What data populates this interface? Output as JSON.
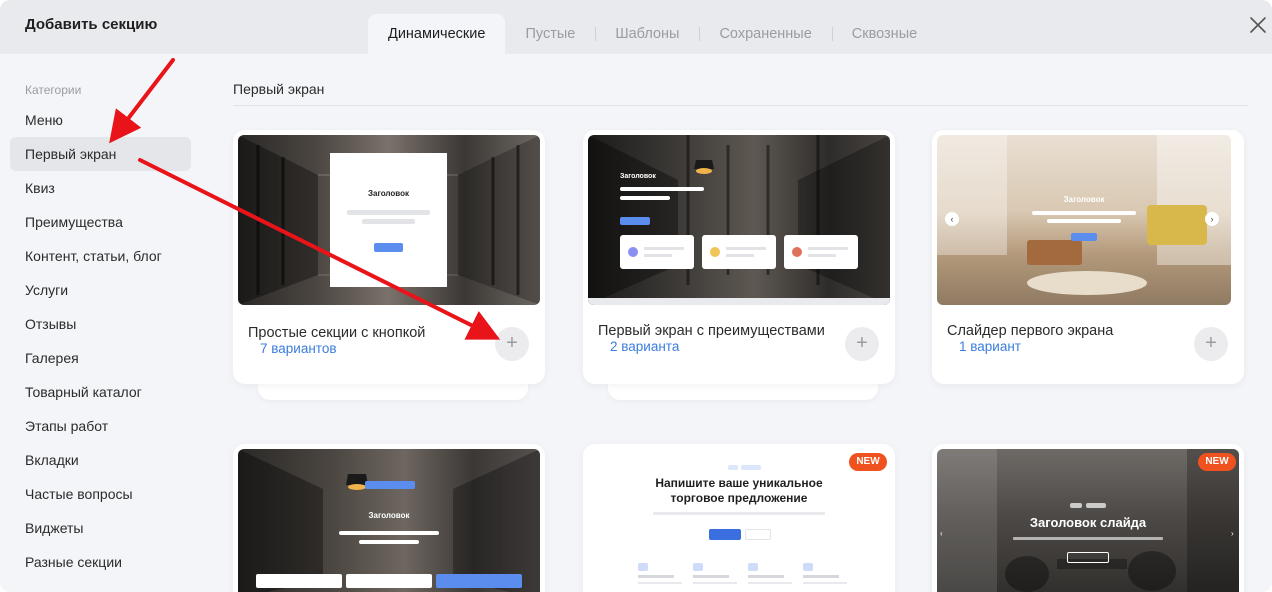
{
  "header": {
    "title": "Добавить секцию",
    "tabs": [
      {
        "label": "Динамические",
        "active": true
      },
      {
        "label": "Пустые",
        "active": false
      },
      {
        "label": "Шаблоны",
        "active": false
      },
      {
        "label": "Сохраненные",
        "active": false
      },
      {
        "label": "Сквозные",
        "active": false
      }
    ],
    "close_icon": "close-icon"
  },
  "sidebar": {
    "heading": "Категории",
    "items": [
      {
        "label": "Меню",
        "active": false
      },
      {
        "label": "Первый экран",
        "active": true
      },
      {
        "label": "Квиз",
        "active": false
      },
      {
        "label": "Преимущества",
        "active": false
      },
      {
        "label": "Контент, статьи, блог",
        "active": false
      },
      {
        "label": "Услуги",
        "active": false
      },
      {
        "label": "Отзывы",
        "active": false
      },
      {
        "label": "Галерея",
        "active": false
      },
      {
        "label": "Товарный каталог",
        "active": false
      },
      {
        "label": "Этапы работ",
        "active": false
      },
      {
        "label": "Вкладки",
        "active": false
      },
      {
        "label": "Частые вопросы",
        "active": false
      },
      {
        "label": "Виджеты",
        "active": false
      },
      {
        "label": "Разные секции",
        "active": false
      }
    ]
  },
  "main": {
    "section_title": "Первый экран",
    "cards": [
      {
        "title": "Простые секции с кнопкой",
        "subtitle": "7 вариантов",
        "preview_heading": "Заголовок"
      },
      {
        "title": "Первый экран с преимуществами",
        "subtitle": "2 варианта",
        "preview_heading": "Заголовок"
      },
      {
        "title": "Слайдер первого экрана",
        "subtitle": "1 вариант",
        "preview_heading": "Заголовок"
      },
      {
        "preview_heading": "Заголовок"
      },
      {
        "badge": "NEW",
        "preview_heading_line1": "Напишите ваше уникальное",
        "preview_heading_line2": "торговое предложение"
      },
      {
        "badge": "NEW",
        "preview_heading": "Заголовок слайда"
      }
    ],
    "plus_label": "+"
  },
  "colors": {
    "accent": "#3b7ddd",
    "badge": "#f0521f",
    "arrow": "#e8141a",
    "preview_button": "#5b8def"
  }
}
